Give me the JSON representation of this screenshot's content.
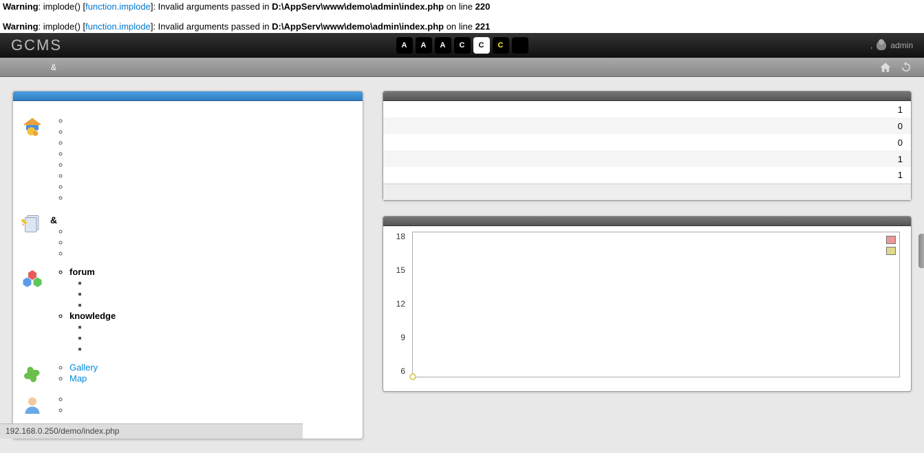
{
  "warnings": [
    {
      "prefix": "Warning",
      "func": ": implode() [",
      "link": "function.implode",
      "suffix": "]: Invalid arguments passed in ",
      "path": "D:\\AppServ\\www\\demo\\admin\\index.php",
      "line": " on line ",
      "lineno": "220"
    },
    {
      "prefix": "Warning",
      "func": ": implode() [",
      "link": "function.implode",
      "suffix": "]: Invalid arguments passed in ",
      "path": "D:\\AppServ\\www\\demo\\admin\\index.php",
      "line": " on line ",
      "lineno": "221"
    }
  ],
  "header": {
    "logo": "GCMS",
    "buttons": [
      "A",
      "A",
      "A",
      "C",
      "C",
      "C",
      ""
    ],
    "user_sep": ",",
    "user_label": "admin"
  },
  "subbar": {
    "crumb": "&"
  },
  "sidebar": {
    "sections": {
      "home_items": [
        "",
        "",
        "",
        "",
        "",
        "",
        "",
        ""
      ],
      "pages_label": "&",
      "pages_items": [
        "",
        "",
        ""
      ],
      "modules": {
        "forum": "forum",
        "forum_sub": [
          "",
          "",
          ""
        ],
        "knowledge": "knowledge",
        "knowledge_sub": [
          "",
          "",
          ""
        ]
      },
      "widgets": [
        {
          "label": "Gallery"
        },
        {
          "label": "Map"
        }
      ],
      "users_items": [
        "",
        ""
      ]
    }
  },
  "stats": {
    "rows": [
      {
        "label": "",
        "value": "1"
      },
      {
        "label": "",
        "value": "0"
      },
      {
        "label": "",
        "value": "0"
      },
      {
        "label": "",
        "value": "1"
      },
      {
        "label": "",
        "value": "1"
      }
    ]
  },
  "chart_data": {
    "type": "line",
    "y_ticks": [
      "18",
      "15",
      "12",
      "9",
      "6"
    ],
    "ylim": [
      6,
      18
    ],
    "series": [
      {
        "name": "",
        "color": "#e89898",
        "values": []
      },
      {
        "name": "",
        "color": "#e0d88a",
        "values": [
          6
        ]
      }
    ],
    "legend_colors": [
      "#e89898",
      "#e0d88a"
    ]
  },
  "status": "192.168.0.250/demo/index.php"
}
